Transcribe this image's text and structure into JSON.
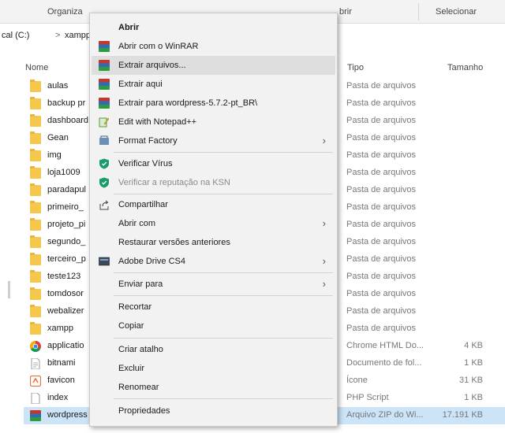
{
  "ribbon": {
    "organize": "Organiza",
    "open": "brir",
    "select": "Selecionar"
  },
  "address": {
    "drive": "cal (C:)",
    "chevron": ">",
    "folder": "xampp"
  },
  "columns": {
    "name": "Nome",
    "type": "Tipo",
    "size": "Tamanho"
  },
  "files": [
    {
      "name": "aulas",
      "type": "Pasta de arquivos",
      "size": "",
      "icon": "folder-icon"
    },
    {
      "name": "backup pr",
      "type": "Pasta de arquivos",
      "size": "",
      "icon": "folder-icon"
    },
    {
      "name": "dashboard",
      "type": "Pasta de arquivos",
      "size": "",
      "icon": "folder-icon"
    },
    {
      "name": "Gean",
      "type": "Pasta de arquivos",
      "size": "",
      "icon": "folder-icon"
    },
    {
      "name": "img",
      "type": "Pasta de arquivos",
      "size": "",
      "icon": "folder-icon"
    },
    {
      "name": "loja1009",
      "type": "Pasta de arquivos",
      "size": "",
      "icon": "folder-icon"
    },
    {
      "name": "paradapul",
      "type": "Pasta de arquivos",
      "size": "",
      "icon": "folder-icon"
    },
    {
      "name": "primeiro_",
      "type": "Pasta de arquivos",
      "size": "",
      "icon": "folder-icon"
    },
    {
      "name": "projeto_pi",
      "type": "Pasta de arquivos",
      "size": "",
      "icon": "folder-icon"
    },
    {
      "name": "segundo_",
      "type": "Pasta de arquivos",
      "size": "",
      "icon": "folder-icon"
    },
    {
      "name": "terceiro_p",
      "type": "Pasta de arquivos",
      "size": "",
      "icon": "folder-icon"
    },
    {
      "name": "teste123",
      "type": "Pasta de arquivos",
      "size": "",
      "icon": "folder-icon"
    },
    {
      "name": "tomdosor",
      "type": "Pasta de arquivos",
      "size": "",
      "icon": "folder-icon"
    },
    {
      "name": "webalizer",
      "type": "Pasta de arquivos",
      "size": "",
      "icon": "folder-icon"
    },
    {
      "name": "xampp",
      "type": "Pasta de arquivos",
      "size": "",
      "icon": "folder-icon"
    },
    {
      "name": "applicatio",
      "type": "Chrome HTML Do...",
      "size": "4 KB",
      "icon": "chrome-icon"
    },
    {
      "name": "bitnami",
      "type": "Documento de fol...",
      "size": "1 KB",
      "icon": "document-icon"
    },
    {
      "name": "favicon",
      "type": "Ícone",
      "size": "31 KB",
      "icon": "favicon-icon"
    },
    {
      "name": "index",
      "type": "PHP Script",
      "size": "1 KB",
      "icon": "php-file-icon"
    },
    {
      "name": "wordpress",
      "type": "Arquivo ZIP do Wi...",
      "size": "17.191 KB",
      "icon": "winrar-archive-icon"
    }
  ],
  "menu": {
    "open": "Abrir",
    "open_with_winrar": "Abrir com o WinRAR",
    "extract_files": "Extrair arquivos...",
    "extract_here": "Extrair aqui",
    "extract_to": "Extrair para wordpress-5.7.2-pt_BR\\",
    "edit_notepad": "Edit with Notepad++",
    "format_factory": "Format Factory",
    "scan_virus": "Verificar Vírus",
    "check_reputation": "Verificar a reputação na KSN",
    "share": "Compartilhar",
    "open_with": "Abrir com",
    "restore_versions": "Restaurar versões anteriores",
    "adobe_drive": "Adobe Drive CS4",
    "send_to": "Enviar para",
    "cut": "Recortar",
    "copy": "Copiar",
    "create_shortcut": "Criar atalho",
    "delete": "Excluir",
    "rename": "Renomear",
    "properties": "Propriedades",
    "submenu_arrow": "›"
  },
  "colors": {
    "selected_row": "#cce4f7",
    "menu_background": "#f2f2f2",
    "menu_highlight": "#dedede",
    "folder": "#f5c84c"
  }
}
